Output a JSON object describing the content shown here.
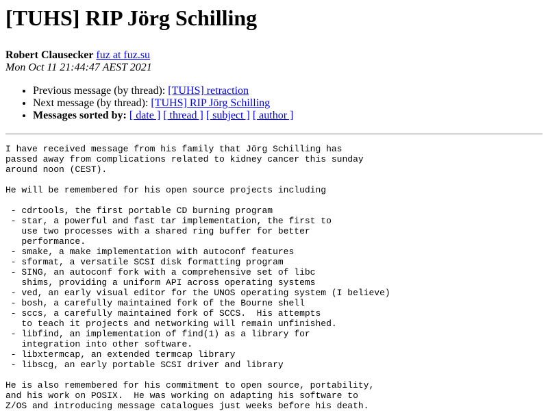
{
  "title": "[TUHS] RIP Jörg Schilling",
  "author": {
    "name": "Robert Clausecker",
    "email_link": "fuz at fuz.su "
  },
  "date": "Mon Oct 11 21:44:47 AEST 2021",
  "nav": {
    "previous_label": "Previous message (by thread): ",
    "previous_link": "[TUHS] retraction",
    "next_label": "Next message (by thread): ",
    "next_link": "[TUHS] RIP Jörg Schilling",
    "sorted_label": "Messages sorted by:",
    "sort_links": {
      "date": "[ date ]",
      "thread": "[ thread ]",
      "subject": "[ subject ]",
      "author": "[ author ]"
    }
  },
  "message_body": "I have received message from his family that Jörg Schilling has\npassed away from complications related to kidney cancer this sunday\naround noon (CEST).\n\nHe will be remembered for his open source projects including\n\n - cdrtools, the first portable CD burning program\n - star, a powerful and fast tar implementation, the first to\n   use two processes with a shared ring buffer for better\n   performance.\n - smake, a make implementation with autoconf features\n - sformat, a versatile SCSI disk formatting program\n - SING, an autoconf fork with a comprehensive set of libc\n   shims, providing a uniform API across operating systems\n - ved, an early visual editor for the UNOS operating system (I believe)\n - bosh, a carefully maintained fork of the Bourne shell\n - sccs, a carefully maintained fork of SCCS.  His attempts\n   to teach it projects and networking will remain unfinished.\n - libfind, an implementation of find(1) as a library for\n   integration into other software.\n - libxtermcap, an extended termcap library\n - libscg, an early portable SCSI driver and library\n\nHe is also remembered for his commitment to open source, portability,\nand his work on POSIX.  He was working on adapting his software to\nZ/OS and introducing message catalogues just weeks before his death."
}
